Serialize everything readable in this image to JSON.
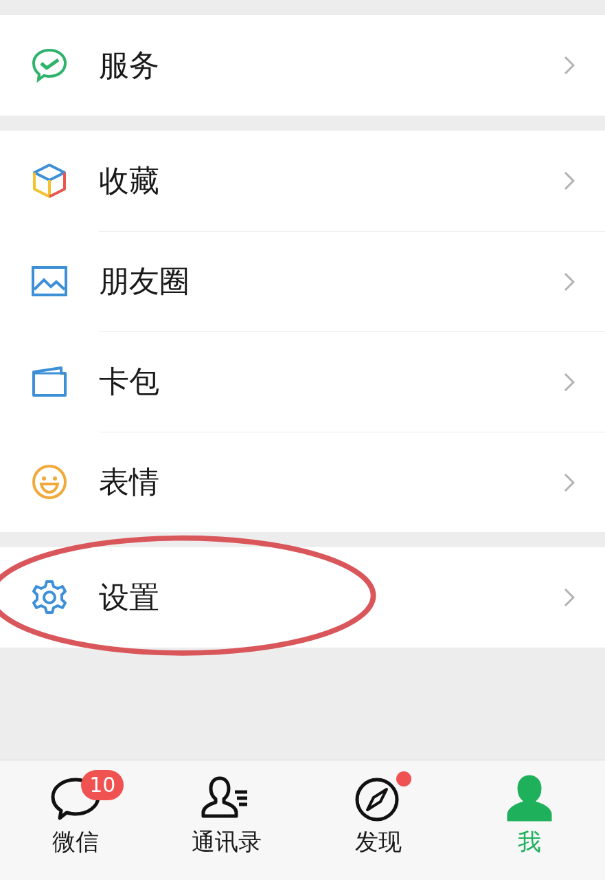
{
  "groups": [
    {
      "items": [
        {
          "kind": "service",
          "label": "服务",
          "circled": false
        }
      ]
    },
    {
      "items": [
        {
          "kind": "favorites",
          "label": "收藏",
          "circled": false
        },
        {
          "kind": "moments",
          "label": "朋友圈",
          "circled": false
        },
        {
          "kind": "wallet",
          "label": "卡包",
          "circled": false
        },
        {
          "kind": "stickers",
          "label": "表情",
          "circled": false
        }
      ]
    },
    {
      "items": [
        {
          "kind": "settings",
          "label": "设置",
          "circled": true
        }
      ]
    }
  ],
  "tab_bar": [
    {
      "kind": "chats",
      "label": "微信",
      "selected": false,
      "badge": "10",
      "dot": false
    },
    {
      "kind": "contacts",
      "label": "通讯录",
      "selected": false,
      "dot": false
    },
    {
      "kind": "discover",
      "label": "发现",
      "selected": false,
      "dot": true
    },
    {
      "kind": "me",
      "label": "我",
      "selected": true,
      "dot": false
    }
  ]
}
